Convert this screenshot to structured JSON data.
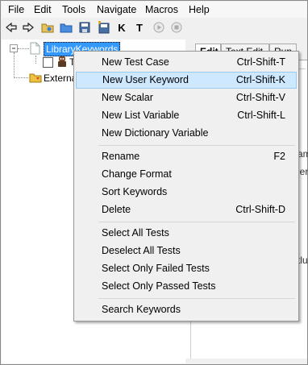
{
  "menubar": {
    "items": [
      "File",
      "Edit",
      "Tools",
      "Navigate",
      "Macros",
      "Help"
    ]
  },
  "toolbar": {
    "buttons": [
      "back-icon",
      "forward-icon",
      "open-suite-icon",
      "open-directory-icon",
      "save-icon",
      "save-all-icon",
      "search-keywords-icon",
      "search-tests-icon",
      "run-icon",
      "stop-icon"
    ],
    "keyword_glyph": "K",
    "test_glyph": "T"
  },
  "tree": {
    "root_label": "LibraryKeywords",
    "child_label": "T",
    "external_label": "Externa"
  },
  "editor": {
    "tabs": [
      "Edit",
      "Text Edit",
      "Run"
    ],
    "fragments": [
      "am",
      "ler",
      "tlu"
    ]
  },
  "context_menu": {
    "groups": [
      [
        {
          "label": "New Test Case",
          "shortcut": "Ctrl-Shift-T"
        },
        {
          "label": "New User Keyword",
          "shortcut": "Ctrl-Shift-K",
          "highlighted": true
        },
        {
          "label": "New Scalar",
          "shortcut": "Ctrl-Shift-V"
        },
        {
          "label": "New List Variable",
          "shortcut": "Ctrl-Shift-L"
        },
        {
          "label": "New Dictionary Variable",
          "shortcut": ""
        }
      ],
      [
        {
          "label": "Rename",
          "shortcut": "F2"
        },
        {
          "label": "Change Format",
          "shortcut": ""
        },
        {
          "label": "Sort Keywords",
          "shortcut": ""
        },
        {
          "label": "Delete",
          "shortcut": "Ctrl-Shift-D"
        }
      ],
      [
        {
          "label": "Select All Tests",
          "shortcut": ""
        },
        {
          "label": "Deselect All Tests",
          "shortcut": ""
        },
        {
          "label": "Select Only Failed Tests",
          "shortcut": ""
        },
        {
          "label": "Select Only Passed Tests",
          "shortcut": ""
        }
      ],
      [
        {
          "label": "Search Keywords",
          "shortcut": ""
        }
      ]
    ]
  },
  "colors": {
    "highlight": "#cde8ff",
    "highlight_border": "#99c9ef",
    "tree_selection": "#3399ff"
  }
}
